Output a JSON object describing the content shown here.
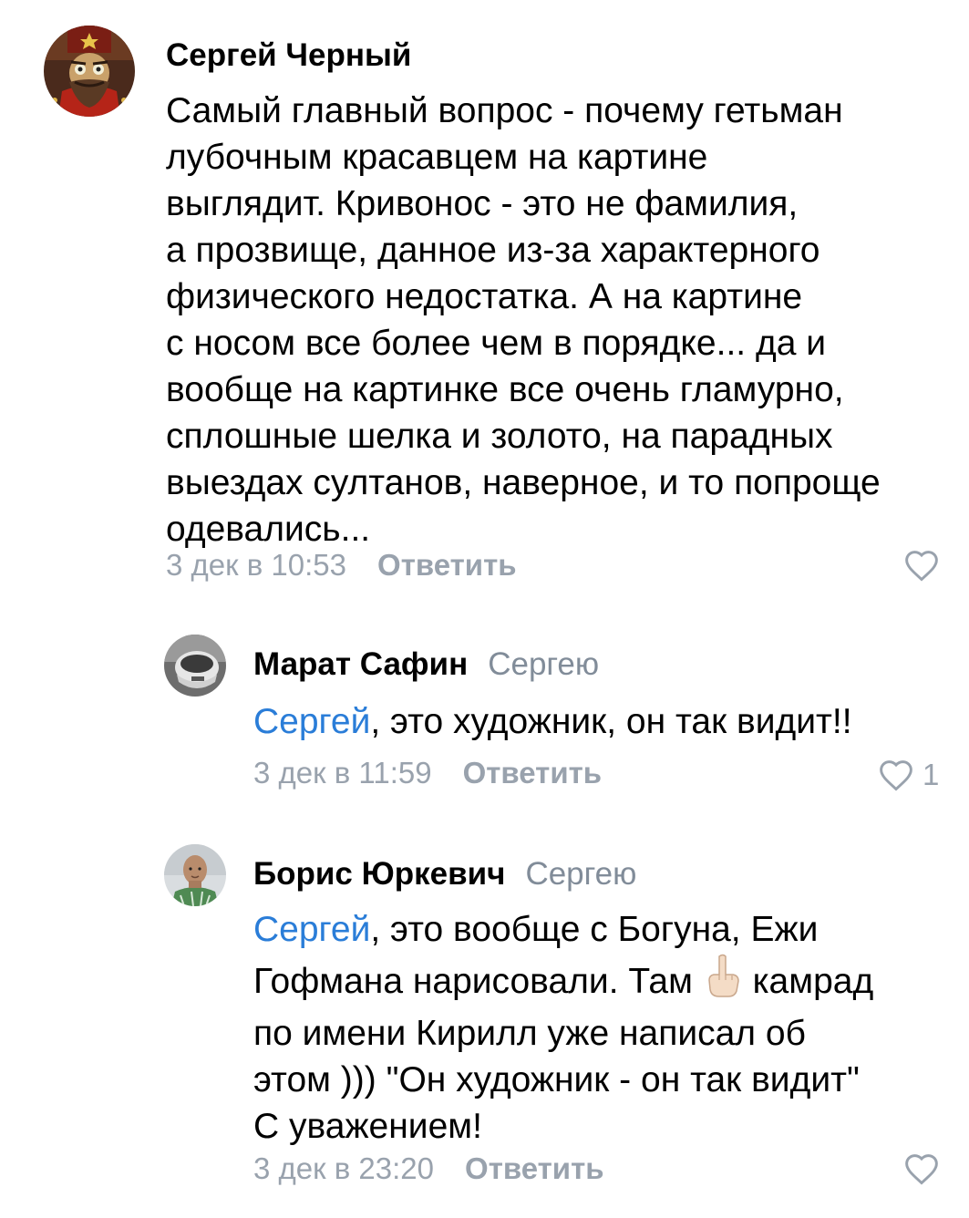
{
  "colors": {
    "mention": "#2a7dd8",
    "secondary_text": "#99a2ad",
    "reply_to": "#818c99"
  },
  "comments": [
    {
      "author": "Сергей Черный",
      "avatar_icon": "soviet-general-avatar",
      "text": "Самый главный вопрос - почему гетьман\nлубочным красавцем на картине\nвыглядит. Кривонос - это не фамилия,\nа прозвище, данное из-за характерного\nфизического недостатка. А на картине\nс носом все более чем в порядке... да и\nвообще на картинке все очень гламурно,\nсплошные шелка и золото, на парадных\nвыездах султанов, наверное, и то попроще\nодевались...",
      "time": "3 дек в 10:53",
      "reply_label": "Ответить",
      "likes": ""
    },
    {
      "author": "Марат Сафин",
      "reply_to": "Сергею",
      "avatar_icon": "cup-avatar",
      "mention": "Сергей",
      "text": ", это художник, он так видит!!",
      "time": "3 дек в 11:59",
      "reply_label": "Ответить",
      "likes": "1"
    },
    {
      "author": "Борис Юркевич",
      "reply_to": "Сергею",
      "avatar_icon": "person-photo-avatar",
      "mention": "Сергей",
      "text_1": ", это вообще с Богуна, Ежи\nГофмана нарисовали. Там",
      "emoji": "point-up-emoji",
      "text_2": "камрад\nпо имени Кирилл уже написал об\nэтом ))) \"Он художник - он так видит\"\nС уважением!",
      "time": "3 дек в 23:20",
      "reply_label": "Ответить",
      "likes": ""
    }
  ]
}
